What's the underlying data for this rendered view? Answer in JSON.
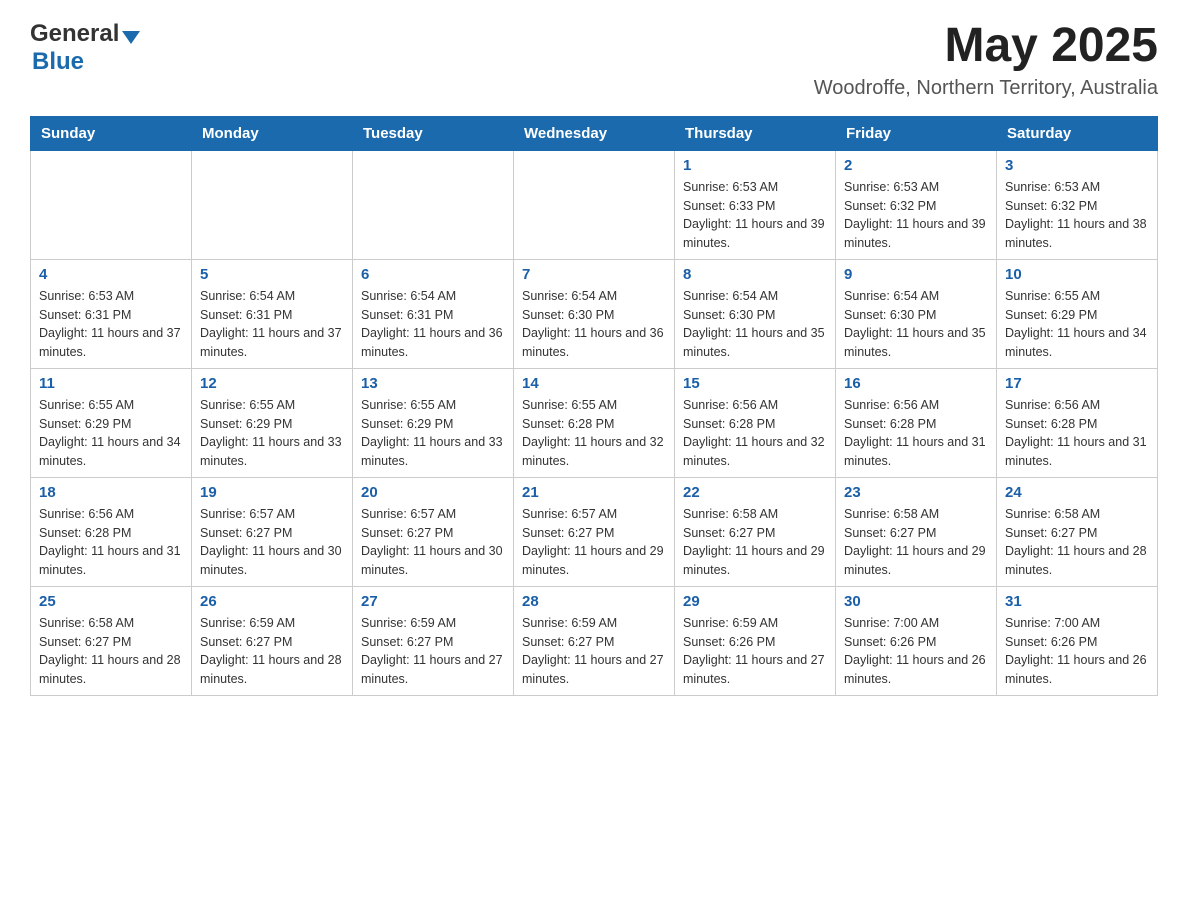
{
  "header": {
    "logo_general": "General",
    "logo_blue": "Blue",
    "month_year": "May 2025",
    "location": "Woodroffe, Northern Territory, Australia"
  },
  "days_of_week": [
    "Sunday",
    "Monday",
    "Tuesday",
    "Wednesday",
    "Thursday",
    "Friday",
    "Saturday"
  ],
  "weeks": [
    [
      {
        "day": "",
        "info": ""
      },
      {
        "day": "",
        "info": ""
      },
      {
        "day": "",
        "info": ""
      },
      {
        "day": "",
        "info": ""
      },
      {
        "day": "1",
        "info": "Sunrise: 6:53 AM\nSunset: 6:33 PM\nDaylight: 11 hours and 39 minutes."
      },
      {
        "day": "2",
        "info": "Sunrise: 6:53 AM\nSunset: 6:32 PM\nDaylight: 11 hours and 39 minutes."
      },
      {
        "day": "3",
        "info": "Sunrise: 6:53 AM\nSunset: 6:32 PM\nDaylight: 11 hours and 38 minutes."
      }
    ],
    [
      {
        "day": "4",
        "info": "Sunrise: 6:53 AM\nSunset: 6:31 PM\nDaylight: 11 hours and 37 minutes."
      },
      {
        "day": "5",
        "info": "Sunrise: 6:54 AM\nSunset: 6:31 PM\nDaylight: 11 hours and 37 minutes."
      },
      {
        "day": "6",
        "info": "Sunrise: 6:54 AM\nSunset: 6:31 PM\nDaylight: 11 hours and 36 minutes."
      },
      {
        "day": "7",
        "info": "Sunrise: 6:54 AM\nSunset: 6:30 PM\nDaylight: 11 hours and 36 minutes."
      },
      {
        "day": "8",
        "info": "Sunrise: 6:54 AM\nSunset: 6:30 PM\nDaylight: 11 hours and 35 minutes."
      },
      {
        "day": "9",
        "info": "Sunrise: 6:54 AM\nSunset: 6:30 PM\nDaylight: 11 hours and 35 minutes."
      },
      {
        "day": "10",
        "info": "Sunrise: 6:55 AM\nSunset: 6:29 PM\nDaylight: 11 hours and 34 minutes."
      }
    ],
    [
      {
        "day": "11",
        "info": "Sunrise: 6:55 AM\nSunset: 6:29 PM\nDaylight: 11 hours and 34 minutes."
      },
      {
        "day": "12",
        "info": "Sunrise: 6:55 AM\nSunset: 6:29 PM\nDaylight: 11 hours and 33 minutes."
      },
      {
        "day": "13",
        "info": "Sunrise: 6:55 AM\nSunset: 6:29 PM\nDaylight: 11 hours and 33 minutes."
      },
      {
        "day": "14",
        "info": "Sunrise: 6:55 AM\nSunset: 6:28 PM\nDaylight: 11 hours and 32 minutes."
      },
      {
        "day": "15",
        "info": "Sunrise: 6:56 AM\nSunset: 6:28 PM\nDaylight: 11 hours and 32 minutes."
      },
      {
        "day": "16",
        "info": "Sunrise: 6:56 AM\nSunset: 6:28 PM\nDaylight: 11 hours and 31 minutes."
      },
      {
        "day": "17",
        "info": "Sunrise: 6:56 AM\nSunset: 6:28 PM\nDaylight: 11 hours and 31 minutes."
      }
    ],
    [
      {
        "day": "18",
        "info": "Sunrise: 6:56 AM\nSunset: 6:28 PM\nDaylight: 11 hours and 31 minutes."
      },
      {
        "day": "19",
        "info": "Sunrise: 6:57 AM\nSunset: 6:27 PM\nDaylight: 11 hours and 30 minutes."
      },
      {
        "day": "20",
        "info": "Sunrise: 6:57 AM\nSunset: 6:27 PM\nDaylight: 11 hours and 30 minutes."
      },
      {
        "day": "21",
        "info": "Sunrise: 6:57 AM\nSunset: 6:27 PM\nDaylight: 11 hours and 29 minutes."
      },
      {
        "day": "22",
        "info": "Sunrise: 6:58 AM\nSunset: 6:27 PM\nDaylight: 11 hours and 29 minutes."
      },
      {
        "day": "23",
        "info": "Sunrise: 6:58 AM\nSunset: 6:27 PM\nDaylight: 11 hours and 29 minutes."
      },
      {
        "day": "24",
        "info": "Sunrise: 6:58 AM\nSunset: 6:27 PM\nDaylight: 11 hours and 28 minutes."
      }
    ],
    [
      {
        "day": "25",
        "info": "Sunrise: 6:58 AM\nSunset: 6:27 PM\nDaylight: 11 hours and 28 minutes."
      },
      {
        "day": "26",
        "info": "Sunrise: 6:59 AM\nSunset: 6:27 PM\nDaylight: 11 hours and 28 minutes."
      },
      {
        "day": "27",
        "info": "Sunrise: 6:59 AM\nSunset: 6:27 PM\nDaylight: 11 hours and 27 minutes."
      },
      {
        "day": "28",
        "info": "Sunrise: 6:59 AM\nSunset: 6:27 PM\nDaylight: 11 hours and 27 minutes."
      },
      {
        "day": "29",
        "info": "Sunrise: 6:59 AM\nSunset: 6:26 PM\nDaylight: 11 hours and 27 minutes."
      },
      {
        "day": "30",
        "info": "Sunrise: 7:00 AM\nSunset: 6:26 PM\nDaylight: 11 hours and 26 minutes."
      },
      {
        "day": "31",
        "info": "Sunrise: 7:00 AM\nSunset: 6:26 PM\nDaylight: 11 hours and 26 minutes."
      }
    ]
  ]
}
